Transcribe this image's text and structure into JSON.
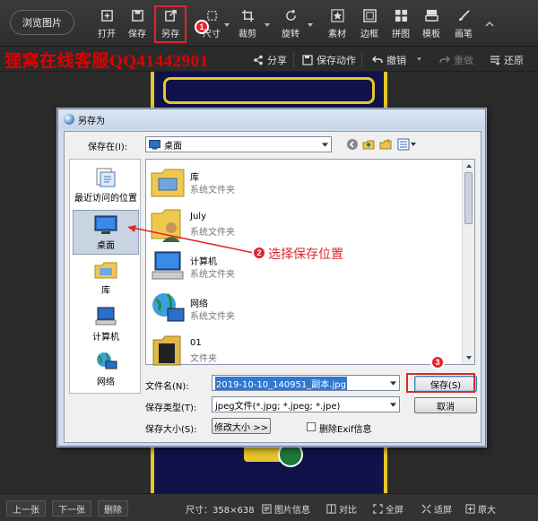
{
  "toolbar": {
    "browse_label": "浏览图片",
    "tools": [
      {
        "id": "open",
        "label": "打开",
        "icon": "open-icon"
      },
      {
        "id": "save",
        "label": "保存",
        "icon": "save-icon"
      },
      {
        "id": "saveas",
        "label": "另存",
        "icon": "save-as-icon"
      },
      {
        "id": "size",
        "label": "尺寸",
        "icon": "resize-icon"
      },
      {
        "id": "crop",
        "label": "裁剪",
        "icon": "crop-icon"
      },
      {
        "id": "rotate",
        "label": "旋转",
        "icon": "rotate-icon"
      },
      {
        "id": "material",
        "label": "素材",
        "icon": "star-icon"
      },
      {
        "id": "border",
        "label": "边框",
        "icon": "border-icon"
      },
      {
        "id": "collage",
        "label": "拼图",
        "icon": "collage-icon"
      },
      {
        "id": "template",
        "label": "模板",
        "icon": "template-icon"
      },
      {
        "id": "brush",
        "label": "画笔",
        "icon": "brush-icon"
      }
    ]
  },
  "subbar": {
    "watermark": "狸窝在线客服QQ41442901",
    "share": "分享",
    "save_action": "保存动作",
    "undo": "撤销",
    "redo": "重做",
    "restore": "还原"
  },
  "dialog": {
    "title": "另存为",
    "save_in_label": "保存在(I):",
    "save_in_value": "桌面",
    "places": [
      {
        "label": "最近访问的位置",
        "icon": "recent-icon"
      },
      {
        "label": "桌面",
        "icon": "desktop-icon"
      },
      {
        "label": "库",
        "icon": "library-icon"
      },
      {
        "label": "计算机",
        "icon": "computer-icon"
      },
      {
        "label": "网络",
        "icon": "network-icon"
      }
    ],
    "files": [
      {
        "name": "库",
        "desc": "系统文件夹",
        "icon": "library-folder-icon"
      },
      {
        "name": "July",
        "desc": "系统文件夹",
        "icon": "user-folder-icon"
      },
      {
        "name": "计算机",
        "desc": "系统文件夹",
        "icon": "computer-icon"
      },
      {
        "name": "网络",
        "desc": "系统文件夹",
        "icon": "network-icon"
      },
      {
        "name": "01",
        "desc": "文件夹",
        "icon": "folder-icon"
      }
    ],
    "filename_label": "文件名(N):",
    "filename_value": "2019-10-10_140951_副本.jpg",
    "filetype_label": "保存类型(T):",
    "filetype_value": "jpeg文件(*.jpg; *.jpeg; *.jpe)",
    "filesize_label": "保存大小(S):",
    "resize_button": "修改大小 >>",
    "exif_label": "删除Exif信息",
    "save_button": "保存(S)",
    "cancel_button": "取消"
  },
  "annotations": {
    "step1": "1",
    "step2_text": "选择保存位置",
    "step2": "2",
    "step3": "3"
  },
  "bottombar": {
    "prev": "上一张",
    "next": "下一张",
    "delete": "删除",
    "size_text": "尺寸：358×638",
    "info": "图片信息",
    "compare": "对比",
    "fullscreen": "全屏",
    "fit": "适屏",
    "original": "原大"
  },
  "colors": {
    "annotation_red": "#e0262c",
    "poster_gold": "#e7c62a",
    "poster_navy": "#10124a"
  }
}
